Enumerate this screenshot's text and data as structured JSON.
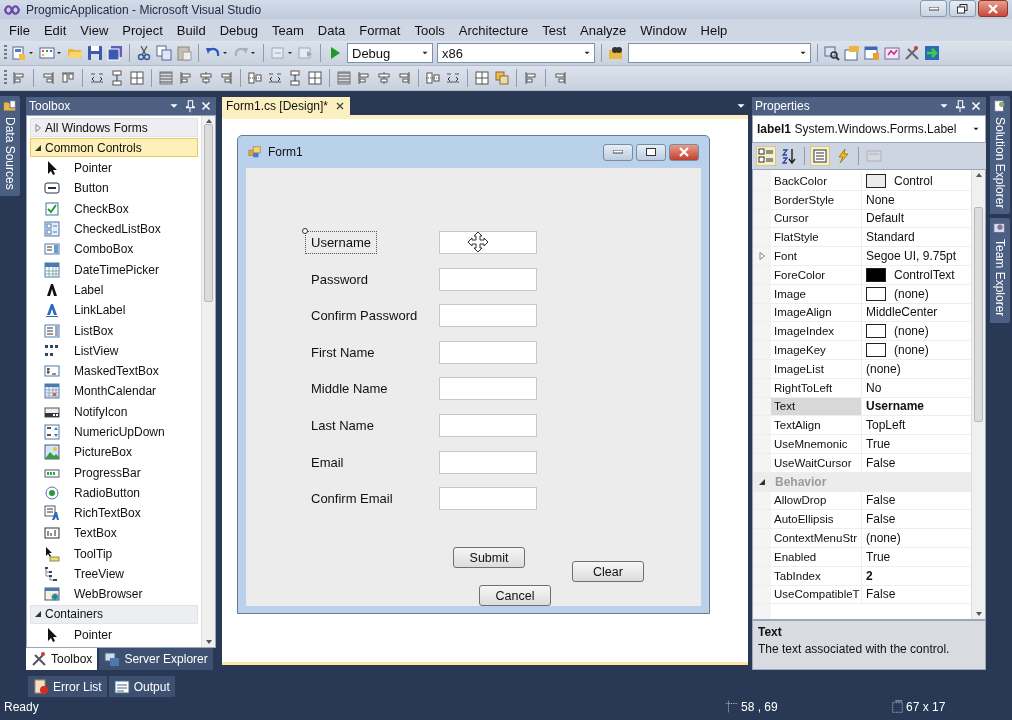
{
  "window": {
    "title": "ProgmicApplication - Microsoft Visual Studio"
  },
  "menu": [
    "File",
    "Edit",
    "View",
    "Project",
    "Build",
    "Debug",
    "Team",
    "Data",
    "Format",
    "Tools",
    "Architecture",
    "Test",
    "Analyze",
    "Window",
    "Help"
  ],
  "toolbar": {
    "configuration": "Debug",
    "platform": "x86"
  },
  "side_tabs_left": [
    "Data Sources"
  ],
  "toolbox": {
    "title": "Toolbox",
    "groups": [
      {
        "label": "All Windows Forms",
        "expanded": false,
        "selected": false
      },
      {
        "label": "Common Controls",
        "expanded": true,
        "selected": true,
        "children": [
          {
            "label": "Pointer",
            "kind": "pointer"
          },
          {
            "label": "Button",
            "kind": "button"
          },
          {
            "label": "CheckBox",
            "kind": "checkbox"
          },
          {
            "label": "CheckedListBox",
            "kind": "checkedlistbox"
          },
          {
            "label": "ComboBox",
            "kind": "combobox"
          },
          {
            "label": "DateTimePicker",
            "kind": "datetimepicker"
          },
          {
            "label": "Label",
            "kind": "label"
          },
          {
            "label": "LinkLabel",
            "kind": "linklabel"
          },
          {
            "label": "ListBox",
            "kind": "listbox"
          },
          {
            "label": "ListView",
            "kind": "listview"
          },
          {
            "label": "MaskedTextBox",
            "kind": "maskedtextbox"
          },
          {
            "label": "MonthCalendar",
            "kind": "monthcalendar"
          },
          {
            "label": "NotifyIcon",
            "kind": "notifyicon"
          },
          {
            "label": "NumericUpDown",
            "kind": "numericupdown"
          },
          {
            "label": "PictureBox",
            "kind": "picturebox"
          },
          {
            "label": "ProgressBar",
            "kind": "progressbar"
          },
          {
            "label": "RadioButton",
            "kind": "radiobutton"
          },
          {
            "label": "RichTextBox",
            "kind": "richtextbox"
          },
          {
            "label": "TextBox",
            "kind": "textbox"
          },
          {
            "label": "ToolTip",
            "kind": "tooltip"
          },
          {
            "label": "TreeView",
            "kind": "treeview"
          },
          {
            "label": "WebBrowser",
            "kind": "webbrowser"
          }
        ]
      },
      {
        "label": "Containers",
        "expanded": true,
        "selected": false,
        "children": [
          {
            "label": "Pointer",
            "kind": "pointer"
          }
        ]
      }
    ],
    "tabs": [
      {
        "label": "Toolbox",
        "selected": true
      },
      {
        "label": "Server Explorer",
        "selected": false
      }
    ]
  },
  "document": {
    "tabs": [
      {
        "label": "Form1.cs [Design]*",
        "selected": true
      }
    ],
    "form": {
      "title": "Form1",
      "fields": [
        {
          "label": "Username",
          "selected": true
        },
        {
          "label": "Password",
          "selected": false
        },
        {
          "label": "Confirm Password",
          "selected": false
        },
        {
          "label": "First Name",
          "selected": false
        },
        {
          "label": "Middle Name",
          "selected": false
        },
        {
          "label": "Last Name",
          "selected": false
        },
        {
          "label": "Email",
          "selected": false
        },
        {
          "label": "Confirm Email",
          "selected": false
        }
      ],
      "buttons": [
        "Submit",
        "Clear",
        "Cancel"
      ]
    }
  },
  "properties": {
    "title": "Properties",
    "object_name": "label1",
    "object_type": "System.Windows.Forms.Label",
    "view_buttons": [
      {
        "kind": "categorized",
        "selected": true,
        "disabled": false
      },
      {
        "kind": "alphabetical",
        "selected": false,
        "disabled": false
      },
      {
        "kind": "properties",
        "selected": true,
        "disabled": false
      },
      {
        "kind": "events",
        "selected": false,
        "disabled": false
      },
      {
        "kind": "property-pages",
        "selected": false,
        "disabled": true
      }
    ],
    "rows": [
      {
        "kind": "property",
        "name": "BackColor",
        "value": "Control",
        "color": "#ececec",
        "modified": false,
        "selected": false
      },
      {
        "kind": "property",
        "name": "BorderStyle",
        "value": "None",
        "modified": false,
        "selected": false
      },
      {
        "kind": "property",
        "name": "Cursor",
        "value": "Default",
        "modified": false,
        "selected": false
      },
      {
        "kind": "property",
        "name": "FlatStyle",
        "value": "Standard",
        "modified": false,
        "selected": false
      },
      {
        "kind": "expandable",
        "name": "Font",
        "value": "Segoe UI, 9.75pt",
        "expanded": false,
        "modified": false,
        "selected": false
      },
      {
        "kind": "property",
        "name": "ForeColor",
        "value": "ControlText",
        "color": "#000000",
        "modified": false,
        "selected": false
      },
      {
        "kind": "property",
        "name": "Image",
        "value": "(none)",
        "color": "#ffffff",
        "modified": false,
        "selected": false
      },
      {
        "kind": "property",
        "name": "ImageAlign",
        "value": "MiddleCenter",
        "modified": false,
        "selected": false
      },
      {
        "kind": "property",
        "name": "ImageIndex",
        "value": "(none)",
        "color": "#ffffff",
        "modified": false,
        "selected": false
      },
      {
        "kind": "property",
        "name": "ImageKey",
        "value": "(none)",
        "color": "#ffffff",
        "modified": false,
        "selected": false
      },
      {
        "kind": "property",
        "name": "ImageList",
        "value": "(none)",
        "modified": false,
        "selected": false
      },
      {
        "kind": "property",
        "name": "RightToLeft",
        "value": "No",
        "modified": false,
        "selected": false
      },
      {
        "kind": "property",
        "name": "Text",
        "value": "Username",
        "modified": true,
        "selected": true
      },
      {
        "kind": "property",
        "name": "TextAlign",
        "value": "TopLeft",
        "modified": false,
        "selected": false
      },
      {
        "kind": "property",
        "name": "UseMnemonic",
        "value": "True",
        "modified": false,
        "selected": false
      },
      {
        "kind": "property",
        "name": "UseWaitCursor",
        "value": "False",
        "modified": false,
        "selected": false
      },
      {
        "kind": "category",
        "name": "Behavior",
        "expanded": true
      },
      {
        "kind": "property",
        "name": "AllowDrop",
        "value": "False",
        "modified": false,
        "selected": false
      },
      {
        "kind": "property",
        "name": "AutoEllipsis",
        "value": "False",
        "modified": false,
        "selected": false
      },
      {
        "kind": "property",
        "name": "ContextMenuStr",
        "value": "(none)",
        "modified": false,
        "selected": false
      },
      {
        "kind": "property",
        "name": "Enabled",
        "value": "True",
        "modified": false,
        "selected": false
      },
      {
        "kind": "property",
        "name": "TabIndex",
        "value": "2",
        "modified": true,
        "selected": false
      },
      {
        "kind": "property",
        "name": "UseCompatibleT",
        "value": "False",
        "modified": false,
        "selected": false
      }
    ],
    "description": {
      "title": "Text",
      "text": "The text associated with the control."
    }
  },
  "side_tabs_right": [
    "Solution Explorer",
    "Team Explorer"
  ],
  "bottom_tabs": [
    "Error List",
    "Output"
  ],
  "status_bar": {
    "text": "Ready",
    "position": "58 , 69",
    "size": "67 x 17"
  }
}
